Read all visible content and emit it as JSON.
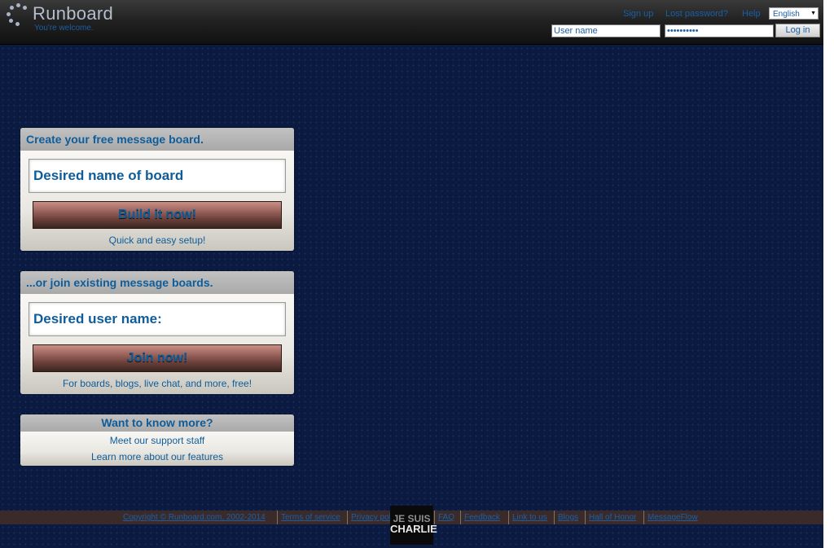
{
  "header": {
    "brand": "Runboard",
    "tagline": "You're welcome.",
    "links": [
      "Sign up",
      "Lost password?",
      "Help"
    ],
    "language": "English",
    "username_placeholder": "User name",
    "password_value": "••••••••••",
    "login_label": "Log in"
  },
  "create_panel": {
    "title": "Create your free message board.",
    "input_placeholder": "Desired name of board",
    "button_label": "Build it now!",
    "subtext": "Quick and easy setup!"
  },
  "join_panel": {
    "title": "...or join existing message boards.",
    "input_placeholder": "Desired user name:",
    "button_label": "Join now!",
    "subtext": "For boards, blogs, live chat, and more, free!"
  },
  "more_panel": {
    "title": "Want to know more?",
    "links": [
      "Meet our support staff",
      "Learn more about our features"
    ]
  },
  "footer": {
    "links": [
      "Copyright © Runboard.com, 2002-2014",
      "Terms of service",
      "Privacy policy",
      "FAQ",
      "Feedback",
      "Link to us",
      "Blogs",
      "Hall of Honor",
      "MessageFlow"
    ],
    "badge_line1": "JE SUIS",
    "badge_line2": "CHARLIE"
  },
  "colors": {
    "background": "#0b1a40",
    "accent_text": "#0e5d9a",
    "button_brown": "#6d413b"
  }
}
